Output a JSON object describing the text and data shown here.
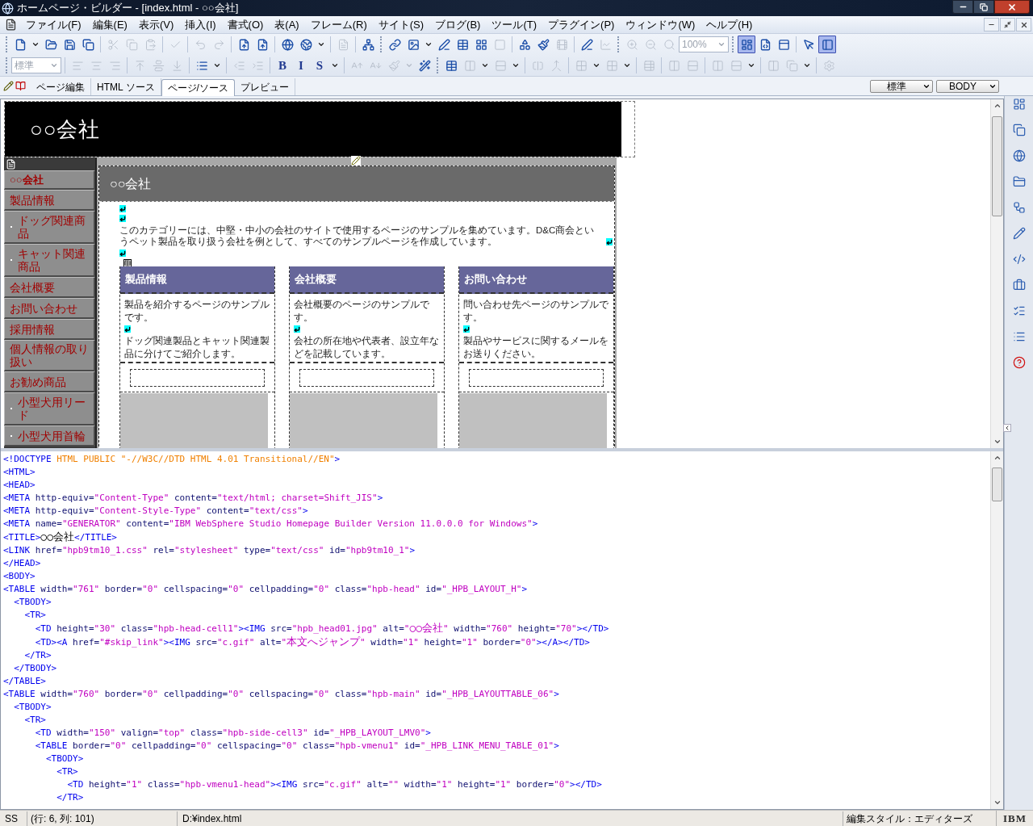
{
  "window": {
    "title": "ホームページ・ビルダー - [index.html - ○○会社]"
  },
  "menu": [
    "ファイル(F)",
    "編集(E)",
    "表示(V)",
    "挿入(I)",
    "書式(O)",
    "表(A)",
    "フレーム(R)",
    "サイト(S)",
    "ブログ(B)",
    "ツール(T)",
    "プラグイン(P)",
    "ウィンドウ(W)",
    "ヘルプ(H)"
  ],
  "toolbars": [
    [
      {
        "kind": "icon",
        "disabled": false
      },
      {
        "kind": "caret",
        "disabled": false
      },
      {
        "kind": "icon",
        "disabled": false
      },
      {
        "kind": "icon",
        "disabled": false
      },
      {
        "kind": "icon",
        "disabled": false
      },
      {
        "kind": "sep"
      },
      {
        "kind": "icon",
        "disabled": true
      },
      {
        "kind": "icon",
        "disabled": true
      },
      {
        "kind": "icon",
        "disabled": true
      },
      {
        "kind": "sep"
      },
      {
        "kind": "icon",
        "disabled": true
      },
      {
        "kind": "sep"
      },
      {
        "kind": "icon",
        "disabled": true
      },
      {
        "kind": "icon",
        "disabled": true
      },
      {
        "kind": "sep"
      },
      {
        "kind": "icon",
        "disabled": false
      },
      {
        "kind": "icon",
        "disabled": false
      },
      {
        "kind": "sep"
      },
      {
        "kind": "icon",
        "disabled": false
      },
      {
        "kind": "icon",
        "disabled": false
      },
      {
        "kind": "caret",
        "disabled": false
      },
      {
        "kind": "sep"
      },
      {
        "kind": "icon",
        "disabled": true
      },
      {
        "kind": "sep"
      },
      {
        "kind": "icon",
        "disabled": false
      },
      {
        "kind": "grip"
      },
      {
        "kind": "icon",
        "disabled": false
      },
      {
        "kind": "icon",
        "disabled": false
      },
      {
        "kind": "caret",
        "disabled": false
      },
      {
        "kind": "icon",
        "disabled": false
      },
      {
        "kind": "icon",
        "disabled": false
      },
      {
        "kind": "icon",
        "disabled": false
      },
      {
        "kind": "icon",
        "disabled": true
      },
      {
        "kind": "sep"
      },
      {
        "kind": "icon",
        "disabled": false
      },
      {
        "kind": "icon",
        "disabled": false
      },
      {
        "kind": "icon",
        "disabled": true
      },
      {
        "kind": "sep"
      },
      {
        "kind": "icon",
        "disabled": false
      },
      {
        "kind": "icon",
        "disabled": true
      },
      {
        "kind": "grip"
      },
      {
        "kind": "icon",
        "disabled": true
      },
      {
        "kind": "icon",
        "disabled": true
      },
      {
        "kind": "icon",
        "disabled": true
      },
      {
        "kind": "combo",
        "value": "100%",
        "disabled": true
      },
      {
        "kind": "grip"
      },
      {
        "kind": "icon",
        "disabled": false,
        "pressed": true
      },
      {
        "kind": "icon",
        "disabled": false
      },
      {
        "kind": "icon",
        "disabled": false
      },
      {
        "kind": "sep"
      },
      {
        "kind": "icon",
        "disabled": false
      },
      {
        "kind": "icon",
        "disabled": false,
        "pressed": true
      }
    ],
    [
      {
        "kind": "combo",
        "value": "標準",
        "disabled": true
      },
      {
        "kind": "sep"
      },
      {
        "kind": "icon",
        "disabled": true
      },
      {
        "kind": "icon",
        "disabled": true
      },
      {
        "kind": "icon",
        "disabled": true
      },
      {
        "kind": "sep"
      },
      {
        "kind": "icon",
        "disabled": true
      },
      {
        "kind": "icon",
        "disabled": true
      },
      {
        "kind": "icon",
        "disabled": true
      },
      {
        "kind": "sep"
      },
      {
        "kind": "icon",
        "disabled": false
      },
      {
        "kind": "caret",
        "disabled": false
      },
      {
        "kind": "sep"
      },
      {
        "kind": "icon",
        "disabled": true
      },
      {
        "kind": "icon",
        "disabled": true
      },
      {
        "kind": "sep"
      },
      {
        "kind": "glyph",
        "label": "B",
        "disabled": false
      },
      {
        "kind": "glyph",
        "label": "I",
        "disabled": false
      },
      {
        "kind": "glyph",
        "label": "S",
        "disabled": false
      },
      {
        "kind": "caret",
        "disabled": false
      },
      {
        "kind": "sep"
      },
      {
        "kind": "icon",
        "disabled": true
      },
      {
        "kind": "icon",
        "disabled": true
      },
      {
        "kind": "icon",
        "disabled": true
      },
      {
        "kind": "caret",
        "disabled": true
      },
      {
        "kind": "icon",
        "disabled": false
      },
      {
        "kind": "grip"
      },
      {
        "kind": "icon",
        "disabled": false
      },
      {
        "kind": "icon",
        "disabled": true
      },
      {
        "kind": "caret",
        "disabled": false
      },
      {
        "kind": "icon",
        "disabled": true
      },
      {
        "kind": "caret",
        "disabled": false
      },
      {
        "kind": "sep"
      },
      {
        "kind": "icon",
        "disabled": true
      },
      {
        "kind": "icon",
        "disabled": true
      },
      {
        "kind": "sep"
      },
      {
        "kind": "icon",
        "disabled": true
      },
      {
        "kind": "caret",
        "disabled": false
      },
      {
        "kind": "icon",
        "disabled": true
      },
      {
        "kind": "caret",
        "disabled": false
      },
      {
        "kind": "sep"
      },
      {
        "kind": "icon",
        "disabled": true
      },
      {
        "kind": "sep"
      },
      {
        "kind": "icon",
        "disabled": true
      },
      {
        "kind": "icon",
        "disabled": true
      },
      {
        "kind": "sep"
      },
      {
        "kind": "icon",
        "disabled": true
      },
      {
        "kind": "icon",
        "disabled": true
      },
      {
        "kind": "caret",
        "disabled": false
      },
      {
        "kind": "sep"
      },
      {
        "kind": "icon",
        "disabled": true
      },
      {
        "kind": "icon",
        "disabled": true
      },
      {
        "kind": "caret",
        "disabled": false
      },
      {
        "kind": "sep"
      },
      {
        "kind": "icon",
        "disabled": true
      }
    ]
  ],
  "view_tabs": [
    {
      "label": "ページ編集",
      "selected": false
    },
    {
      "label": "HTML ソース",
      "selected": false
    },
    {
      "label": "ページ/ソース",
      "selected": true
    },
    {
      "label": "プレビュー",
      "selected": false
    }
  ],
  "style_selects": [
    "標準",
    "BODY"
  ],
  "page": {
    "header": "○○会社",
    "side_menu": [
      {
        "label": "○○会社",
        "kind": "top"
      },
      {
        "label": "製品情報",
        "kind": "main"
      },
      {
        "label": "ドッグ関連商品",
        "kind": "sub"
      },
      {
        "label": "キャット関連商品",
        "kind": "sub"
      },
      {
        "label": "会社概要",
        "kind": "main"
      },
      {
        "label": "お問い合わせ",
        "kind": "main"
      },
      {
        "label": "採用情報",
        "kind": "main"
      },
      {
        "label": "個人情報の取り扱い",
        "kind": "main"
      },
      {
        "label": "お勧め商品",
        "kind": "main"
      },
      {
        "label": "小型犬用リード",
        "kind": "sub"
      },
      {
        "label": "小型犬用首輪",
        "kind": "sub"
      }
    ],
    "title": "○○会社",
    "intro": "このカテゴリーには、中堅・中小の会社のサイトで使用するページのサンプルを集めています。D&C商会というペット製品を取り扱う会社を例として、すべてのサンプルページを作成しています。",
    "columns": [
      {
        "title": "製品情報",
        "lines": [
          "製品を紹介するページのサンプルです。",
          "ドッグ関連製品とキャット関連製品に分けてご紹介します。"
        ]
      },
      {
        "title": "会社概要",
        "lines": [
          "会社概要のページのサンプルです。",
          "会社の所在地や代表者、設立年などを記載しています。"
        ]
      },
      {
        "title": "お問い合わせ",
        "lines": [
          "問い合わせ先ページのサンプルです。",
          "製品やサービスに関するメールをお送りください。"
        ]
      }
    ]
  },
  "source": [
    "<!DOCTYPE HTML PUBLIC \"-//W3C//DTD HTML 4.01 Transitional//EN\">",
    "<HTML>",
    "<HEAD>",
    "<META http-equiv=\"Content-Type\" content=\"text/html; charset=Shift_JIS\">",
    "<META http-equiv=\"Content-Style-Type\" content=\"text/css\">",
    "<META name=\"GENERATOR\" content=\"IBM WebSphere Studio Homepage Builder Version 11.0.0.0 for Windows\">",
    "<TITLE>○○会社</TITLE>",
    "<LINK href=\"hpb9tm10_1.css\" rel=\"stylesheet\" type=\"text/css\" id=\"hpb9tm10_1\">",
    "</HEAD>",
    "<BODY>",
    "<TABLE width=\"761\" border=\"0\" cellspacing=\"0\" cellpadding=\"0\" class=\"hpb-head\" id=\"_HPB_LAYOUT_H\">",
    "  <TBODY>",
    "    <TR>",
    "      <TD height=\"30\" class=\"hpb-head-cell1\"><IMG src=\"hpb_head01.jpg\" alt=\"○○会社\" width=\"760\" height=\"70\"></TD>",
    "      <TD><A href=\"#skip_link\"><IMG src=\"c.gif\" alt=\"本文へジャンプ\" width=\"1\" height=\"1\" border=\"0\"></A></TD>",
    "    </TR>",
    "  </TBODY>",
    "</TABLE>",
    "<TABLE width=\"760\" border=\"0\" cellpadding=\"0\" cellspacing=\"0\" class=\"hpb-main\" id=\"_HPB_LAYOUTTABLE_06\">",
    "  <TBODY>",
    "    <TR>",
    "      <TD width=\"150\" valign=\"top\" class=\"hpb-side-cell3\" id=\"_HPB_LAYOUT_LMV0\">",
    "      <TABLE border=\"0\" cellpadding=\"0\" cellspacing=\"0\" class=\"hpb-vmenu1\" id=\"_HPB_LINK_MENU_TABLE_01\">",
    "        <TBODY>",
    "          <TR>",
    "            <TD height=\"1\" class=\"hpb-vmenu1-head\"><IMG src=\"c.gif\" alt=\"\" width=\"1\" height=\"1\" border=\"0\"></TD>",
    "          </TR>"
  ],
  "status_bar": {
    "mode": "SS",
    "position": "(行: 6, 列: 101)",
    "path": "D:¥index.html",
    "edit_style": "編集スタイル：エディターズ",
    "logo": "IBM"
  }
}
